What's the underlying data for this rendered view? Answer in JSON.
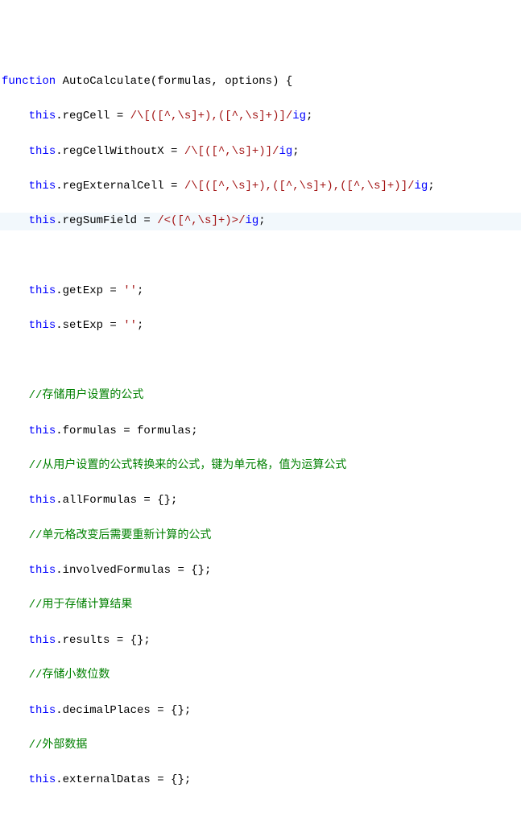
{
  "lines": {
    "l1": {
      "kw": "function",
      "name": "AutoCalculate",
      "params": "(formulas, options) {"
    },
    "l2": {
      "indent": "    ",
      "this": "this",
      "assign": ".regCell = ",
      "re": "/\\[([^,\\s]+),([^,\\s]+)]/",
      "flags": "ig",
      "semi": ";"
    },
    "l3": {
      "indent": "    ",
      "this": "this",
      "assign": ".regCellWithoutX = ",
      "re": "/\\[([^,\\s]+)]/",
      "flags": "ig",
      "semi": ";"
    },
    "l4": {
      "indent": "    ",
      "this": "this",
      "assign": ".regExternalCell = ",
      "re": "/\\[([^,\\s]+),([^,\\s]+),([^,\\s]+)]/",
      "flags": "ig",
      "semi": ";"
    },
    "l5": {
      "indent": "    ",
      "this": "this",
      "assign": ".regSumField = ",
      "re": "/<([^,\\s]+)>/",
      "flags": "ig",
      "semi": ";"
    },
    "l6": " ",
    "l7": {
      "indent": "    ",
      "this": "this",
      "assign": ".getExp = ",
      "str": "''",
      "semi": ";"
    },
    "l8": {
      "indent": "    ",
      "this": "this",
      "assign": ".setExp = ",
      "str": "''",
      "semi": ";"
    },
    "l9": " ",
    "c1": "    //存储用户设置的公式",
    "l10": {
      "indent": "    ",
      "this": "this",
      "text": ".formulas = formulas;"
    },
    "c2": "    //从用户设置的公式转换来的公式，键为单元格，值为运算公式",
    "l11": {
      "indent": "    ",
      "this": "this",
      "text": ".allFormulas = {};"
    },
    "c3": "    //单元格改变后需要重新计算的公式",
    "l12": {
      "indent": "    ",
      "this": "this",
      "text": ".involvedFormulas = {};"
    },
    "c4": "    //用于存储计算结果",
    "l13": {
      "indent": "    ",
      "this": "this",
      "text": ".results = {};"
    },
    "c5": "    //存储小数位数",
    "l14": {
      "indent": "    ",
      "this": "this",
      "text": ".decimalPlaces = {};"
    },
    "c6": "    //外部数据",
    "l15": {
      "indent": "    ",
      "this": "this",
      "text": ".externalDatas = {};"
    }
  }
}
